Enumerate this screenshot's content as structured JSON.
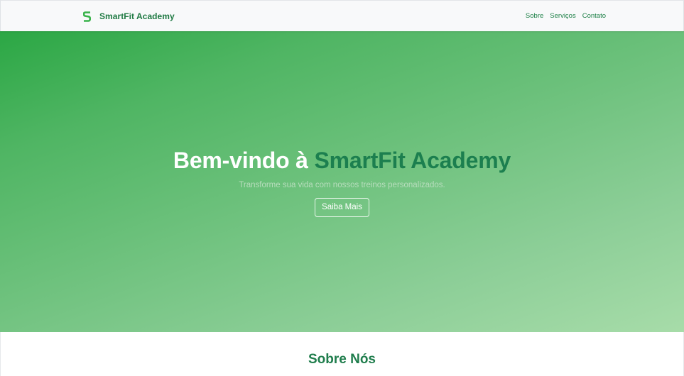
{
  "navbar": {
    "brand_name": "SmartFit Academy",
    "logo_icon": "smartfit-s-logo-icon",
    "links": [
      {
        "label": "Sobre"
      },
      {
        "label": "Serviços"
      },
      {
        "label": "Contato"
      }
    ]
  },
  "hero": {
    "title_prefix": "Bem-vindo à ",
    "title_accent": "SmartFit Academy",
    "subtitle": "Transforme sua vida com nossos treinos personalizados.",
    "button_label": "Saiba Mais"
  },
  "about": {
    "title": "Sobre Nós"
  },
  "colors": {
    "brand_green": "#1f7a43",
    "hero_gradient_start": "#2ba744",
    "hero_gradient_end": "#a7dca9",
    "accent_text": "#1c7f4f",
    "navbar_bg": "#f8f9fa"
  }
}
